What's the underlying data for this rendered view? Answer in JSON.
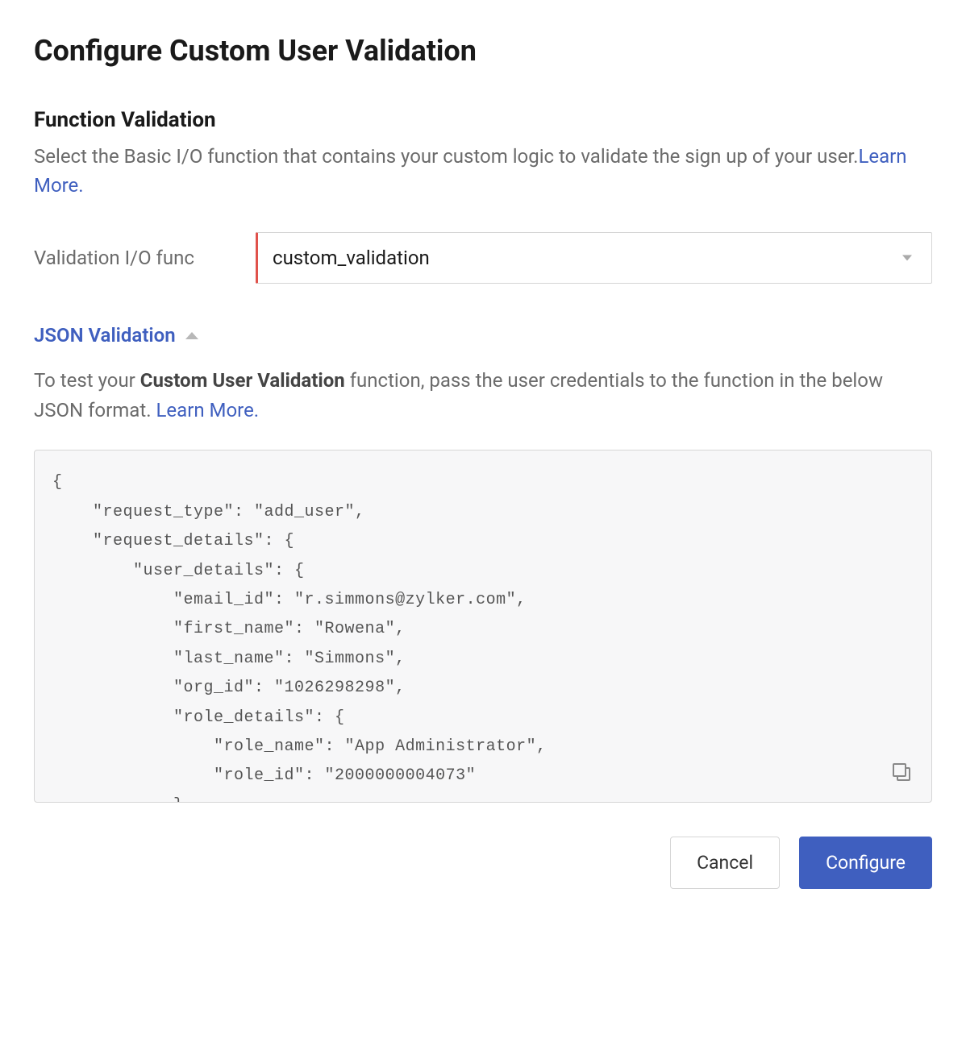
{
  "page": {
    "title": "Configure Custom User Validation"
  },
  "function_validation": {
    "heading": "Function Validation",
    "description": "Select the Basic I/O function that contains your custom logic to validate the sign up of your user.",
    "learn_more": "Learn More.",
    "field_label": "Validation I/O func",
    "selected_value": "custom_validation"
  },
  "json_validation": {
    "heading": "JSON Validation",
    "desc_pre": "To test your ",
    "desc_strong": "Custom User Validation",
    "desc_post": " function, pass the user credentials to the function in the below JSON format. ",
    "learn_more": "Learn More.",
    "code": "{\n    \"request_type\": \"add_user\",\n    \"request_details\": {\n        \"user_details\": {\n            \"email_id\": \"r.simmons@zylker.com\",\n            \"first_name\": \"Rowena\",\n            \"last_name\": \"Simmons\",\n            \"org_id\": \"1026298298\",\n            \"role_details\": {\n                \"role_name\": \"App Administrator\",\n                \"role_id\": \"2000000004073\"\n            }"
  },
  "buttons": {
    "cancel": "Cancel",
    "configure": "Configure"
  }
}
